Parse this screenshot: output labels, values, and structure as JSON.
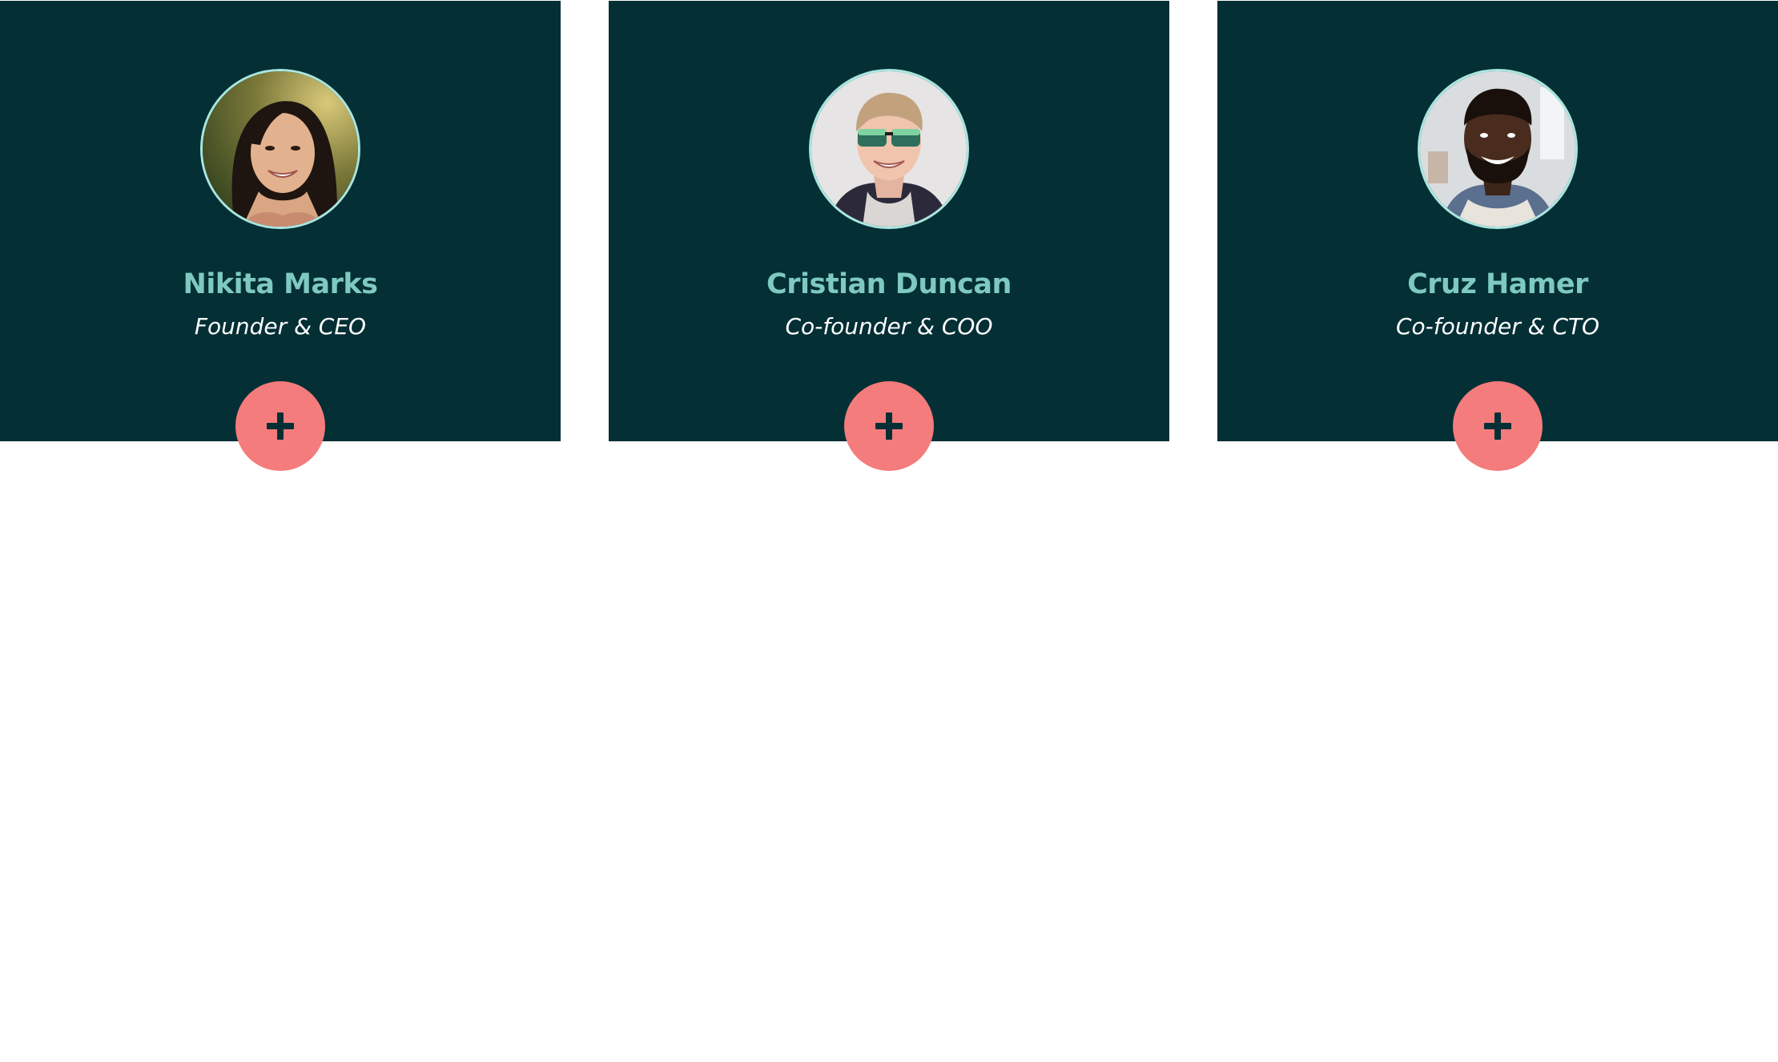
{
  "team": {
    "members": [
      {
        "name": "Nikita Marks",
        "role": "Founder & CEO",
        "photo_bg": "#8f8a45",
        "expand_icon": "plus-icon"
      },
      {
        "name": "Cristian Duncan",
        "role": "Co-founder & COO",
        "photo_bg": "#e6e4e4",
        "expand_icon": "plus-icon"
      },
      {
        "name": "Cruz Hamer",
        "role": "Co-founder & CTO",
        "photo_bg": "#d9dde0",
        "expand_icon": "plus-icon"
      }
    ]
  },
  "colors": {
    "card_bg": "#042f35",
    "name_text": "#7ec9c1",
    "role_text": "#ffffff",
    "button_bg": "#f47c7c",
    "avatar_border": "#a9e6df"
  }
}
